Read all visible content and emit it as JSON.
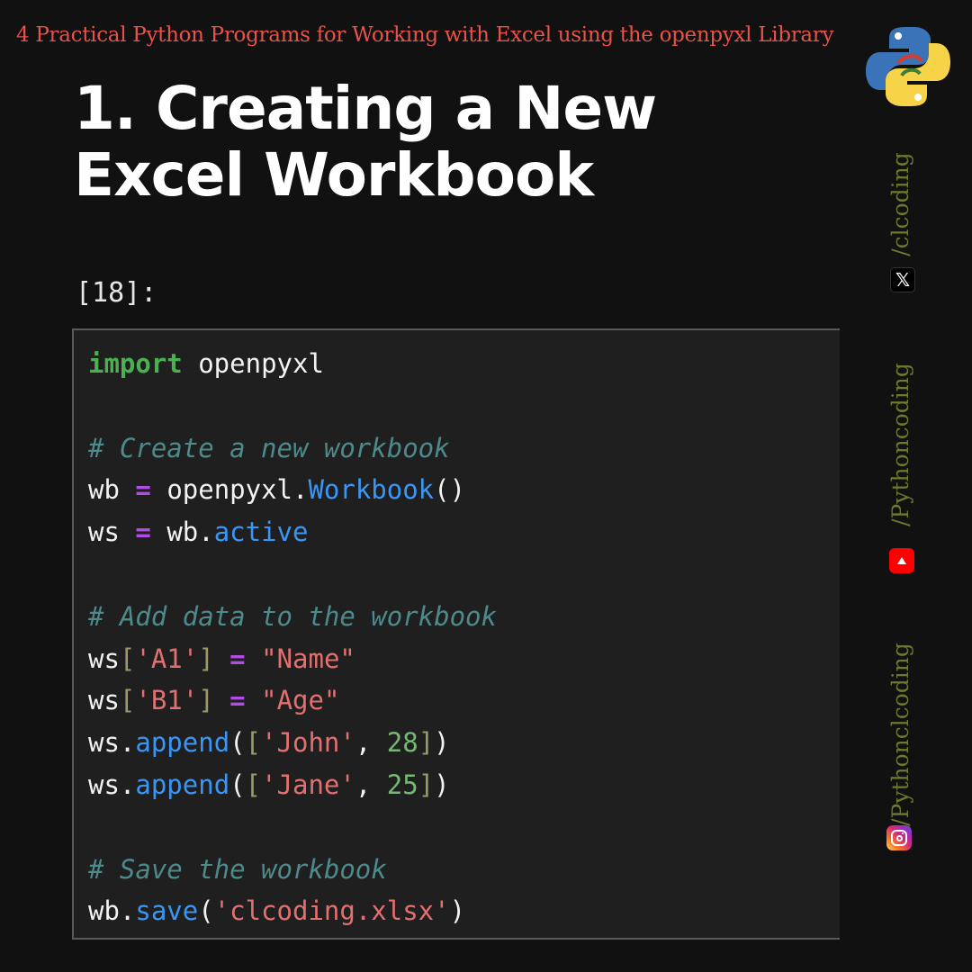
{
  "banner": "4 Practical Python Programs for Working with Excel using the openpyxl Library",
  "heading": "1. Creating a New Excel Workbook",
  "cell": {
    "prompt": "[18]:",
    "lines": [
      [
        [
          "kw",
          "import"
        ],
        [
          "tx",
          " openpyxl"
        ]
      ],
      [],
      [
        [
          "cm",
          "# Create a new workbook"
        ]
      ],
      [
        [
          "tx",
          "wb "
        ],
        [
          "op",
          "="
        ],
        [
          "tx",
          " openpyxl."
        ],
        [
          "fn",
          "Workbook"
        ],
        [
          "tx",
          "()"
        ]
      ],
      [
        [
          "tx",
          "ws "
        ],
        [
          "op",
          "="
        ],
        [
          "tx",
          " wb."
        ],
        [
          "fn",
          "active"
        ]
      ],
      [],
      [
        [
          "cm",
          "# Add data to the workbook"
        ]
      ],
      [
        [
          "tx",
          "ws"
        ],
        [
          "br",
          "["
        ],
        [
          "st",
          "'A1'"
        ],
        [
          "br",
          "]"
        ],
        [
          "tx",
          " "
        ],
        [
          "op",
          "="
        ],
        [
          "tx",
          " "
        ],
        [
          "st",
          "\"Name\""
        ]
      ],
      [
        [
          "tx",
          "ws"
        ],
        [
          "br",
          "["
        ],
        [
          "st",
          "'B1'"
        ],
        [
          "br",
          "]"
        ],
        [
          "tx",
          " "
        ],
        [
          "op",
          "="
        ],
        [
          "tx",
          " "
        ],
        [
          "st",
          "\"Age\""
        ]
      ],
      [
        [
          "tx",
          "ws."
        ],
        [
          "fn",
          "append"
        ],
        [
          "tx",
          "("
        ],
        [
          "br",
          "["
        ],
        [
          "st",
          "'John'"
        ],
        [
          "tx",
          ", "
        ],
        [
          "nm",
          "28"
        ],
        [
          "br",
          "]"
        ],
        [
          "tx",
          ")"
        ]
      ],
      [
        [
          "tx",
          "ws."
        ],
        [
          "fn",
          "append"
        ],
        [
          "tx",
          "("
        ],
        [
          "br",
          "["
        ],
        [
          "st",
          "'Jane'"
        ],
        [
          "tx",
          ", "
        ],
        [
          "nm",
          "25"
        ],
        [
          "br",
          "]"
        ],
        [
          "tx",
          ")"
        ]
      ],
      [],
      [
        [
          "cm",
          "# Save the workbook"
        ]
      ],
      [
        [
          "tx",
          "wb."
        ],
        [
          "fn",
          "save"
        ],
        [
          "tx",
          "("
        ],
        [
          "st",
          "'clcoding.xlsx'"
        ],
        [
          "tx",
          ")"
        ]
      ]
    ]
  },
  "social": {
    "x_handle": "/clcoding",
    "x_icon": "x-logo-icon",
    "youtube_handle": "/Pythoncoding",
    "youtube_icon": "youtube-icon",
    "instagram_handle": "/Pythonclcoding",
    "instagram_icon": "instagram-icon"
  },
  "logo_icon": "python-logo-icon",
  "colors": {
    "banner": "#e8524a",
    "keyword": "#4caf50",
    "comment": "#4e8a8a",
    "operator": "#b14ce6",
    "function": "#3a96f5",
    "string": "#e36f6f",
    "number": "#76b874",
    "bracket": "#9b9a6a",
    "side_text": "#6b7a2e"
  }
}
